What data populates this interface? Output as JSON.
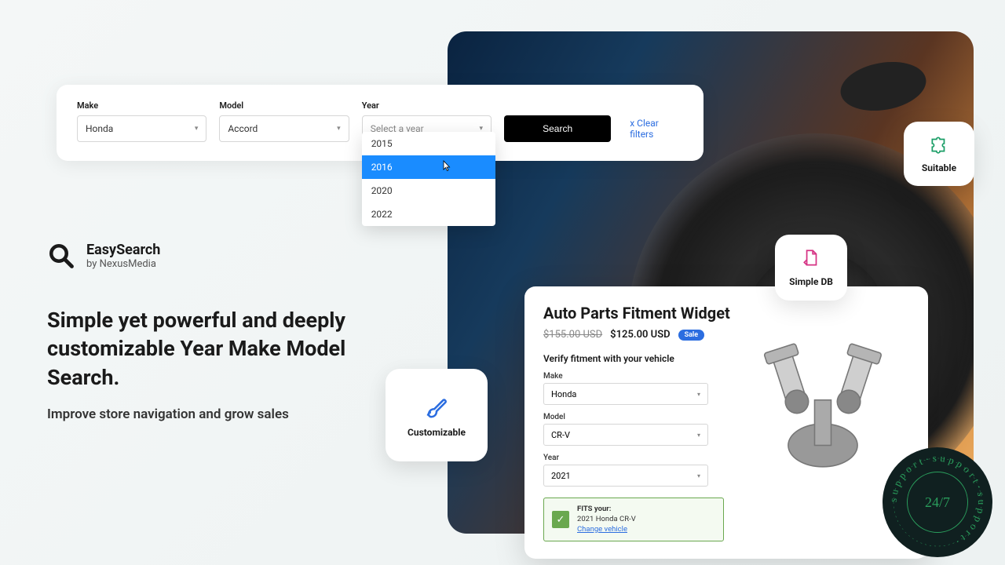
{
  "searchbar": {
    "make": {
      "label": "Make",
      "value": "Honda"
    },
    "model": {
      "label": "Model",
      "value": "Accord"
    },
    "year": {
      "label": "Year",
      "placeholder": "Select a year",
      "options": [
        "2015",
        "2016",
        "2020",
        "2022"
      ],
      "highlighted": "2016"
    },
    "search_btn": "Search",
    "clear": "x Clear filters"
  },
  "brand": {
    "name": "EasySearch",
    "byline": "by NexusMedia"
  },
  "headline": "Simple yet powerful and deeply customizable Year Make Model Search.",
  "subhead": "Improve store navigation and grow sales",
  "tiles": {
    "suitable": "Suitable",
    "simpledb": "Simple DB",
    "customizable": "Customizable"
  },
  "product": {
    "title": "Auto Parts Fitment Widget",
    "price_old": "$155.00 USD",
    "price_new": "$125.00 USD",
    "sale": "Sale",
    "verify": "Verify fitment with your vehicle",
    "make": {
      "label": "Make",
      "value": "Honda"
    },
    "model": {
      "label": "Model",
      "value": "CR-V"
    },
    "year": {
      "label": "Year",
      "value": "2021"
    },
    "fits_label": "FITS your:",
    "fits_vehicle": "2021 Honda CR-V",
    "change": "Change vehicle"
  },
  "support": {
    "center": "24/7",
    "ring": "support·support·support·"
  }
}
